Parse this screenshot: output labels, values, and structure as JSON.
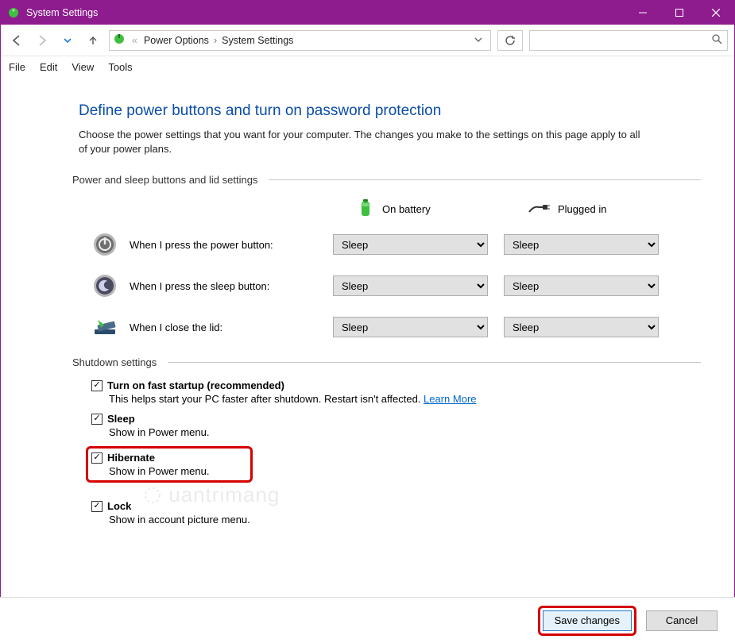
{
  "window": {
    "title": "System Settings"
  },
  "breadcrumb": {
    "pre": "«",
    "a": "Power Options",
    "b": "System Settings"
  },
  "menu": {
    "file": "File",
    "edit": "Edit",
    "view": "View",
    "tools": "Tools"
  },
  "page": {
    "title": "Define power buttons and turn on password protection",
    "desc": "Choose the power settings that you want for your computer. The changes you make to the settings on this page apply to all of your power plans."
  },
  "section1": {
    "label": "Power and sleep buttons and lid settings",
    "col_battery": "On battery",
    "col_plugged": "Plugged in",
    "rows": [
      {
        "label": "When I press the power button:",
        "battery": "Sleep",
        "plugged": "Sleep"
      },
      {
        "label": "When I press the sleep button:",
        "battery": "Sleep",
        "plugged": "Sleep"
      },
      {
        "label": "When I close the lid:",
        "battery": "Sleep",
        "plugged": "Sleep"
      }
    ]
  },
  "section2": {
    "label": "Shutdown settings",
    "items": [
      {
        "title": "Turn on fast startup (recommended)",
        "desc": "This helps start your PC faster after shutdown. Restart isn't affected. ",
        "link": "Learn More",
        "checked": true
      },
      {
        "title": "Sleep",
        "desc": "Show in Power menu.",
        "checked": true
      },
      {
        "title": "Hibernate",
        "desc": "Show in Power menu.",
        "checked": true
      },
      {
        "title": "Lock",
        "desc": "Show in account picture menu.",
        "checked": true
      }
    ]
  },
  "footer": {
    "save": "Save changes",
    "cancel": "Cancel"
  },
  "watermark": "uantrimang"
}
